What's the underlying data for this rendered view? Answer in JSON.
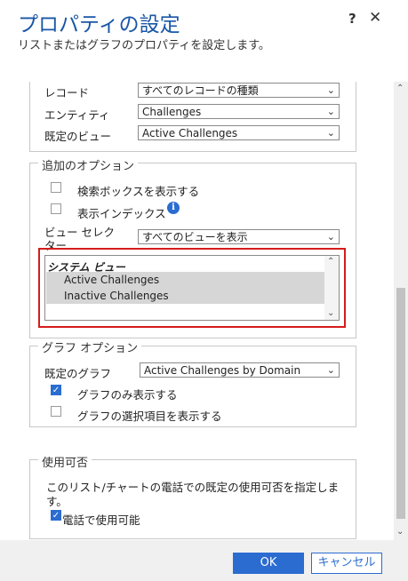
{
  "dialog": {
    "title": "プロパティの設定",
    "subtitle": "リストまたはグラフのプロパティを設定します。",
    "help_label": "?",
    "close_label": "✕"
  },
  "data_source": {
    "record_label": "レコード",
    "record_value": "すべてのレコードの種類",
    "entity_label": "エンティティ",
    "entity_value": "Challenges",
    "default_view_label": "既定のビュー",
    "default_view_value": "Active Challenges"
  },
  "additional_options": {
    "legend": "追加のオプション",
    "show_search_label": "検索ボックスを表示する",
    "show_search_checked": false,
    "show_index_label": "表示インデックス",
    "show_index_checked": false,
    "view_selector_label_line1": "ビュー セレク",
    "view_selector_label_line2": "ター",
    "view_selector_value": "すべてのビューを表示",
    "views_list": {
      "group_header": "システム ビュー",
      "items": [
        "Active Challenges",
        "Inactive Challenges"
      ]
    }
  },
  "chart_options": {
    "legend": "グラフ オプション",
    "default_chart_label": "既定のグラフ",
    "default_chart_value": "Active Challenges by Domain",
    "show_chart_only_label": "グラフのみ表示する",
    "show_chart_only_checked": true,
    "show_chart_selection_label": "グラフの選択項目を表示する",
    "show_chart_selection_checked": false
  },
  "availability": {
    "legend": "使用可否",
    "description": "このリスト/チャートの電話での既定の使用可否を指定しま",
    "description_line2": "す。",
    "phone_available_label": "電話で使用可能",
    "phone_available_checked": true
  },
  "footer": {
    "ok_label": "OK",
    "cancel_label": "キャンセル"
  },
  "colors": {
    "title": "#1a56a6",
    "accent": "#2b6cd1",
    "highlight_box": "#d41c1c",
    "selected_item": "#d6d6d6"
  }
}
